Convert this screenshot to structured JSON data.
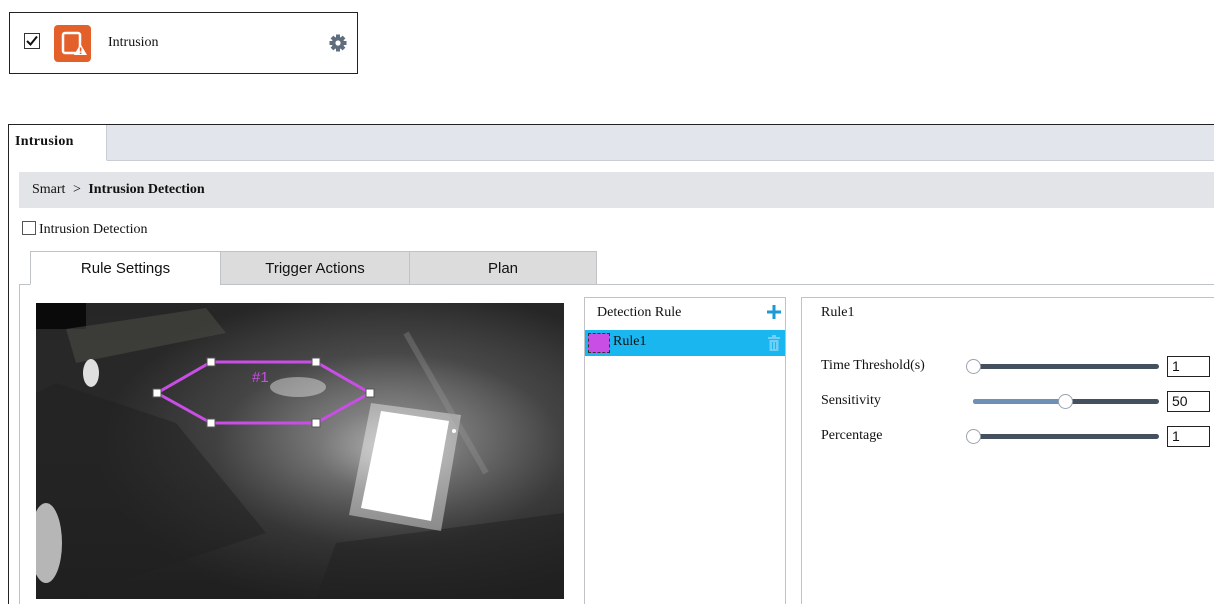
{
  "card": {
    "checked": true,
    "label": "Intrusion",
    "icon": "intrusion-app-icon",
    "settings_icon": "gear-icon"
  },
  "panel": {
    "tab_label": "Intrusion",
    "breadcrumb": {
      "root": "Smart",
      "separator": ">",
      "current": "Intrusion Detection"
    },
    "enable_label": "Intrusion Detection",
    "enable_checked": false,
    "subtabs": [
      "Rule Settings",
      "Trigger Actions",
      "Plan"
    ],
    "active_subtab": "Rule Settings"
  },
  "video": {
    "zone_label": "#1",
    "zone_color": "#c84ee6"
  },
  "rules": {
    "header": "Detection Rule",
    "add_icon": "plus-icon",
    "delete_icon": "trash-icon",
    "items": [
      {
        "name": "Rule1",
        "color": "#c84ee6",
        "selected": true
      }
    ]
  },
  "rule_props": {
    "title": "Rule1",
    "time_threshold": {
      "label": "Time Threshold(s)",
      "value": "1",
      "min": 1,
      "max": 100
    },
    "sensitivity": {
      "label": "Sensitivity",
      "value": "50",
      "min": 1,
      "max": 100
    },
    "percentage": {
      "label": "Percentage",
      "value": "1",
      "min": 1,
      "max": 100
    }
  },
  "colors": {
    "accent": "#19b6f0",
    "app_icon": "#e4602a",
    "slider_track": "#44505e"
  }
}
